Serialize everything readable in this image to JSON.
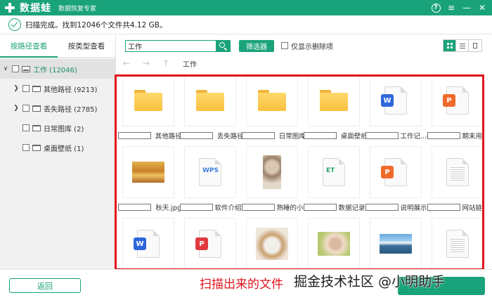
{
  "titlebar": {
    "app_name": "数据蛙",
    "subtitle": "数据恢复专家",
    "help": "?",
    "menu": "≡",
    "minimize": "—",
    "close": "✕"
  },
  "status": {
    "text": "扫描完成。找到12046个文件共4.12 GB。"
  },
  "left_tabs": [
    {
      "label": "按路径查看"
    },
    {
      "label": "按类型查看"
    }
  ],
  "tree": [
    {
      "label": "工作 (12046)"
    },
    {
      "label": "其他路径 (9213)"
    },
    {
      "label": "丢失路径 (2785)"
    },
    {
      "label": "日常图库 (2)"
    },
    {
      "label": "桌面壁纸 (1)"
    }
  ],
  "toolbar": {
    "search_value": "工作",
    "filter_label": "筛选器",
    "only_deleted_label": "仅显示删除项"
  },
  "nav": {
    "back": "←",
    "forward": "→",
    "up": "↑",
    "path": "工作"
  },
  "files": [
    {
      "name": "其他路径",
      "kind": "folder"
    },
    {
      "name": "丢失路径",
      "kind": "folder"
    },
    {
      "name": "日常图库",
      "kind": "folder"
    },
    {
      "name": "桌面壁纸",
      "kind": "folder"
    },
    {
      "name": "工作记...ocx",
      "kind": "word"
    },
    {
      "name": "期末用.pptx",
      "kind": "ppt"
    },
    {
      "name": "秋天.jpg",
      "kind": "photo-autumn"
    },
    {
      "name": "软件介绍....wps",
      "kind": "wps"
    },
    {
      "name": "熟睡的小猫.jpg",
      "kind": "photo-kitten"
    },
    {
      "name": "数据记录表.et",
      "kind": "et"
    },
    {
      "name": "说明展示.pptx",
      "kind": "ppt"
    },
    {
      "name": "网站链接.txt",
      "kind": "txt"
    },
    {
      "name": "",
      "kind": "word"
    },
    {
      "name": "",
      "kind": "pdf"
    },
    {
      "name": "",
      "kind": "photo-cat2"
    },
    {
      "name": "",
      "kind": "photo-rabbit"
    },
    {
      "name": "",
      "kind": "photo-lake"
    },
    {
      "name": "",
      "kind": "txt"
    }
  ],
  "badges": {
    "word": "W",
    "ppt": "P",
    "wps": "WPS",
    "et": "ET",
    "pdf": "P"
  },
  "bottom": {
    "back_label": "返回"
  },
  "annotation": {
    "caption": "扫描出来的文件",
    "watermark": "掘金技术社区 @小明助手"
  },
  "colors": {
    "accent": "#1aa37a",
    "annotation_red": "#e0141c",
    "word_blue": "#2e67d9",
    "ppt_orange": "#ef6a2a",
    "pdf_red": "#e0393e",
    "wps_blue": "#3d7de0",
    "et_green": "#2ea36a"
  }
}
